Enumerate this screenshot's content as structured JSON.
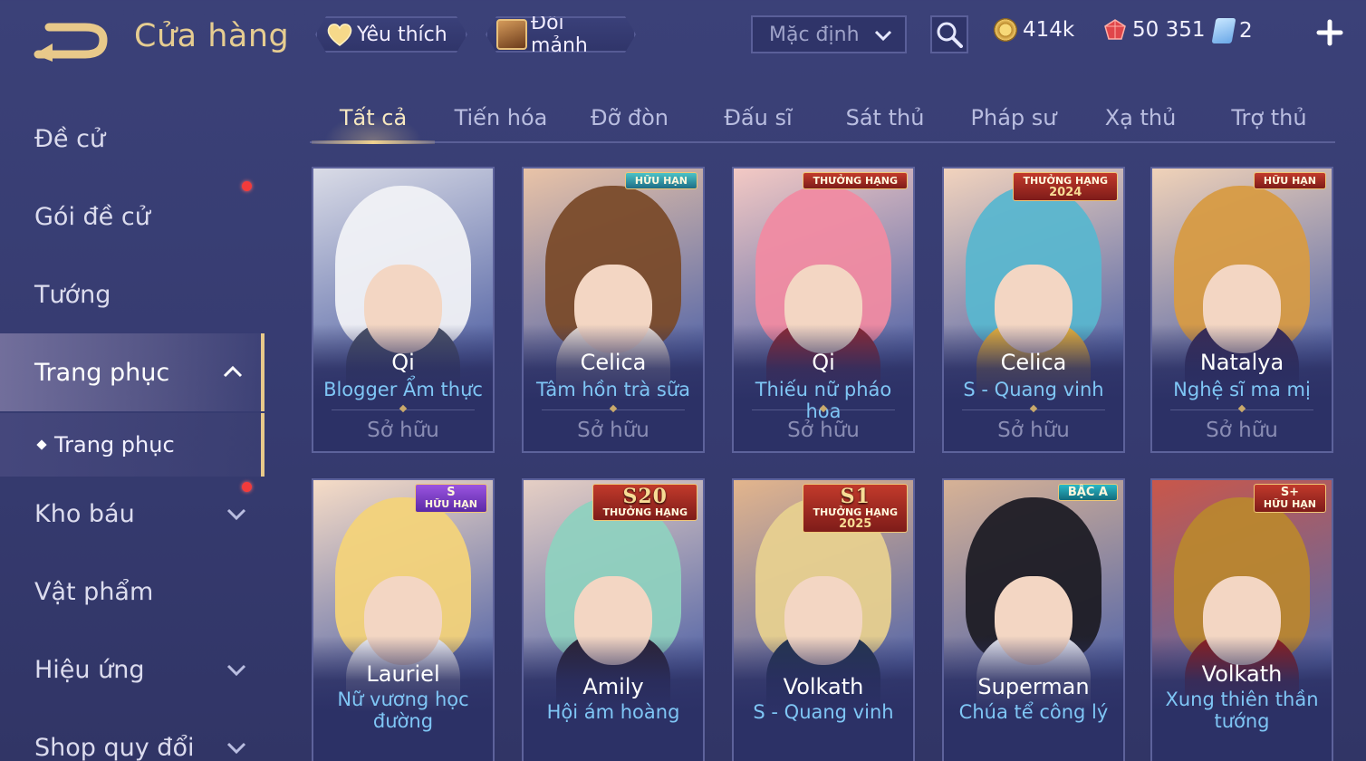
{
  "header": {
    "title": "Cửa hàng",
    "favorites_label": "Yêu thích",
    "exchange_label": "Đổi mảnh",
    "sort_value": "Mặc định",
    "currencies": {
      "gold": "414k",
      "ruby": "50 351",
      "ticket": "2"
    }
  },
  "sidebar": {
    "items": [
      {
        "label": "Đề cử"
      },
      {
        "label": "Gói đề cử"
      },
      {
        "label": "Tướng"
      },
      {
        "label": "Trang phục"
      },
      {
        "label": "Kho báu"
      },
      {
        "label": "Vật phẩm"
      },
      {
        "label": "Hiệu ứng"
      },
      {
        "label": "Shop quy đổi"
      }
    ],
    "sub_item": "Trang phục"
  },
  "tabs": [
    "Tất cả",
    "Tiến hóa",
    "Đỡ đòn",
    "Đấu sĩ",
    "Sát thủ",
    "Pháp sư",
    "Xạ thủ",
    "Trợ thủ"
  ],
  "cards": [
    {
      "hero": "Qi",
      "skin": "Blogger Ẩm thực",
      "status": "Sở hữu",
      "badge": "",
      "art": "#d9dbe6",
      "hair": "#f0f1f6",
      "body": "#4b5266"
    },
    {
      "hero": "Celica",
      "skin": "Tâm hồn trà sữa",
      "status": "Sở hữu",
      "badge": "HỮU HẠN",
      "art": "#e9c3a7",
      "hair": "#7a4b2a",
      "body": "#e8dcd2"
    },
    {
      "hero": "Qi",
      "skin": "Thiếu nữ pháo hoa",
      "status": "Sở hữu",
      "badge": "THƯỞNG HẠNG",
      "art": "#f3c9c4",
      "hair": "#f08ba2",
      "body": "#8c2a35"
    },
    {
      "hero": "Celica",
      "skin": "S - Quang vinh",
      "status": "Sở hữu",
      "badge": "THƯỞNG HẠNG",
      "badge_year": "2024",
      "art": "#f2d3bd",
      "hair": "#5ab6cf",
      "body": "#e8b23a"
    },
    {
      "hero": "Natalya",
      "skin": "Nghệ sĩ ma mị",
      "status": "Sở hữu",
      "badge": "HỮU HẠN",
      "art": "#f0d2b8",
      "hair": "#d79b45",
      "body": "#3a2c55"
    },
    {
      "hero": "Lauriel",
      "skin": "Nữ vương học đường",
      "badge": "S",
      "badge_sub": "HỮU HẠN",
      "art": "#f6dcc6",
      "hair": "#f3d37a",
      "body": "#f1f1f4"
    },
    {
      "hero": "Amily",
      "skin": "Hội ám hoàng",
      "badge": "S20",
      "badge_sub": "THƯỞNG HẠNG",
      "art": "#e6cfc4",
      "hair": "#8fd1bf",
      "body": "#2b2333"
    },
    {
      "hero": "Volkath",
      "skin": "S - Quang vinh",
      "badge": "S1",
      "badge_sub": "THƯỞNG HẠNG",
      "badge_year": "2025",
      "art": "#e3b58c",
      "hair": "#e7d08f",
      "body": "#24354f"
    },
    {
      "hero": "Superman",
      "skin": "Chúa tể công lý",
      "badge": "BẬC A",
      "art": "#d7b295",
      "hair": "#1d1c25",
      "body": "#e5e6ee"
    },
    {
      "hero": "Volkath",
      "skin": "Xung thiên thần tướng",
      "badge": "S+",
      "badge_sub": "HỮU HẠN",
      "art": "#c9574a",
      "hair": "#b9862f",
      "body": "#8d1f1f"
    }
  ]
}
